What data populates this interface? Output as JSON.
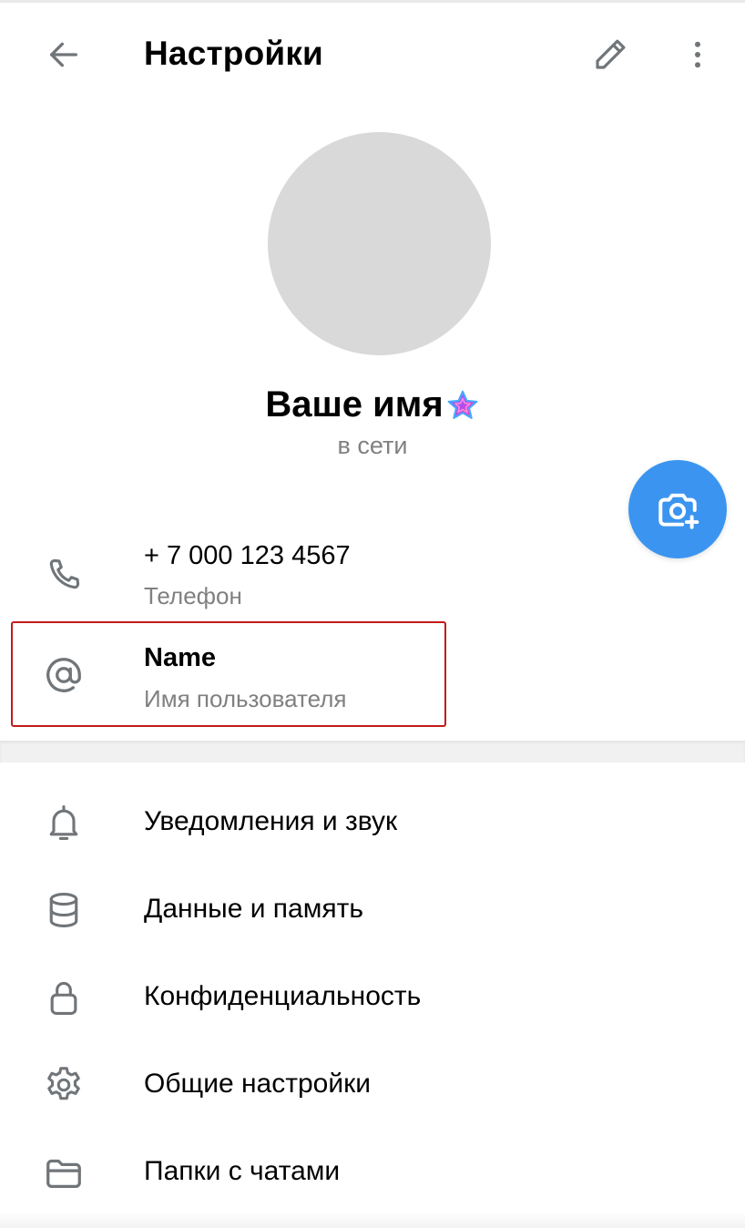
{
  "header": {
    "title": "Настройки",
    "back_icon": "arrow-left-icon",
    "edit_icon": "pencil-icon",
    "more_icon": "more-vertical-icon"
  },
  "profile": {
    "name": "Ваше имя",
    "status": "в сети",
    "badge_icon": "premium-star-icon",
    "camera_icon": "camera-add-icon",
    "accent_color": "#3b95f0"
  },
  "info": {
    "phone": {
      "value": "+ 7 000 123 4567",
      "label": "Телефон",
      "icon": "phone-icon"
    },
    "username": {
      "value": "Name",
      "label": "Имя пользователя",
      "icon": "at-icon"
    }
  },
  "menu": {
    "items": [
      {
        "label": "Уведомления и звук",
        "icon": "bell-icon"
      },
      {
        "label": "Данные и память",
        "icon": "database-icon"
      },
      {
        "label": "Конфиденциальность",
        "icon": "lock-icon"
      },
      {
        "label": "Общие настройки",
        "icon": "gear-icon"
      },
      {
        "label": "Папки с чатами",
        "icon": "folder-icon"
      }
    ]
  },
  "colors": {
    "icon_gray": "#707579",
    "secondary_text": "#808080",
    "highlight_border": "#c21a1a"
  }
}
